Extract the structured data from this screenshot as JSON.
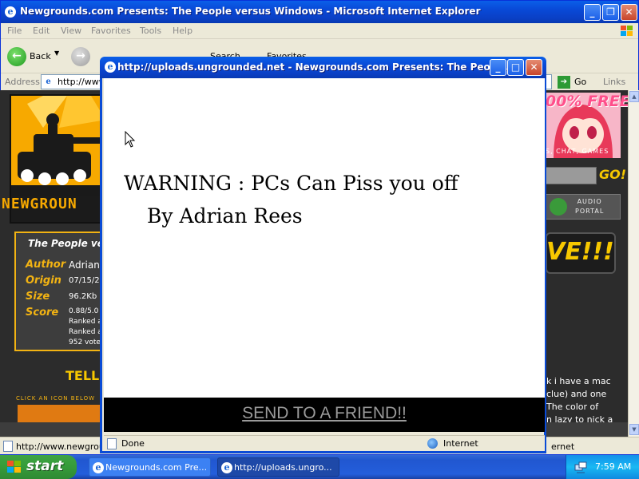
{
  "main_window": {
    "title": "Newgrounds.com Presents: The People versus Windows - Microsoft Internet Explorer",
    "menu": [
      "File",
      "Edit",
      "View",
      "Favorites",
      "Tools",
      "Help"
    ],
    "toolbar": {
      "back_label": "Back",
      "search_label": "Search",
      "favorites_label": "Favorites"
    },
    "address": {
      "label": "Address",
      "url": "http://www",
      "go_label": "Go",
      "links_label": "Links"
    },
    "status": {
      "url": "http://www.newgrou",
      "zone_partial": "ernet"
    }
  },
  "page": {
    "logo_text": "NEWGROUN",
    "movie_title": "The People ve",
    "info": [
      {
        "key": "Author",
        "value": "Adrian"
      },
      {
        "key": "Origin",
        "value": "07/15/20"
      },
      {
        "key": "Size",
        "value": "96.2Kb"
      },
      {
        "key": "Score",
        "value": "0.88/5.0"
      }
    ],
    "ranked1": "Ranked a",
    "ranked2": "Ranked a",
    "votes": "952 vote",
    "tell": "TELL",
    "click_icon": "CLICK AN ICON BELOW",
    "ad_free": "00% FREE!",
    "ad_sub": "S, CHAT, GAMES",
    "go_search": "GO!",
    "audio_portal": [
      "AUDIO",
      "PORTAL"
    ],
    "live": "VE!!!",
    "comments": [
      "k i have a mac",
      "clue) and one",
      "The color of",
      "n lazy to nick a"
    ]
  },
  "popup": {
    "title": "http://uploads.ungrounded.net - Newgrounds.com Presents: The Peopl...",
    "warning_line1": "WARNING : PCs Can Piss you off",
    "warning_line2": "By Adrian Rees",
    "send_link": "SEND TO A FRIEND!!",
    "status_done": "Done",
    "status_zone": "Internet"
  },
  "taskbar": {
    "start_label": "start",
    "tasks": [
      {
        "label": "Newgrounds.com Pre..."
      },
      {
        "label": "http://uploads.ungro..."
      }
    ],
    "clock": "7:59 AM"
  },
  "colors": {
    "xp_blue": "#0a4bd6",
    "ng_orange": "#f7a900",
    "ng_yellow": "#f2b313",
    "start_green": "#3fa343"
  }
}
